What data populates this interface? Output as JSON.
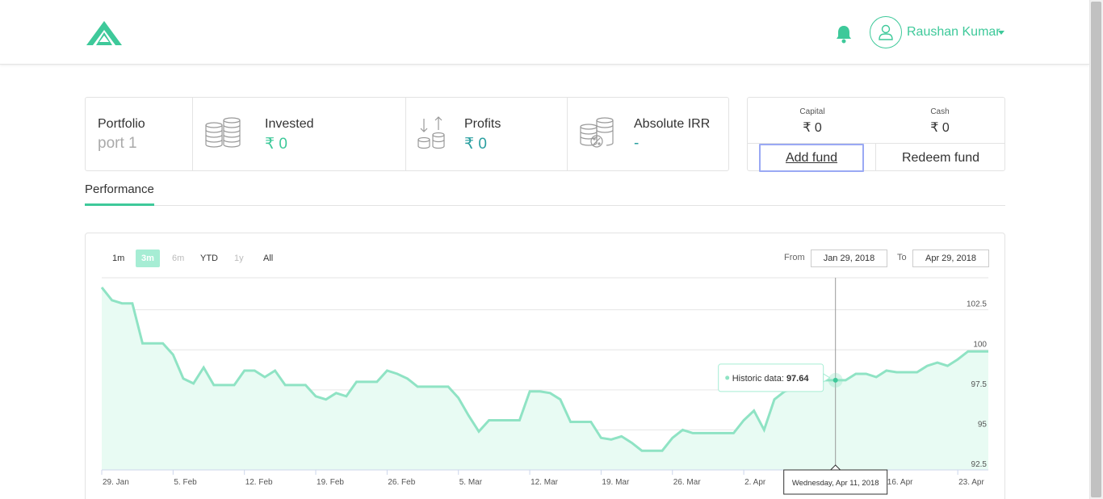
{
  "header": {
    "logo": "logo-icon",
    "bell": "bell-icon",
    "user_name": "Raushan Kumar"
  },
  "summary": {
    "portfolio_label": "Portfolio",
    "portfolio_value": "port 1",
    "invested_label": "Invested",
    "invested_value": "₹ 0",
    "profits_label": "Profits",
    "profits_value": "₹ 0",
    "irr_label": "Absolute IRR",
    "irr_value": "-"
  },
  "funds": {
    "capital_label": "Capital",
    "capital_value": "₹ 0",
    "cash_label": "Cash",
    "cash_value": "₹ 0",
    "add_label": "Add fund",
    "redeem_label": "Redeem fund"
  },
  "tabs": {
    "performance": "Performance"
  },
  "range": {
    "buttons": [
      {
        "label": "1m",
        "state": "normal"
      },
      {
        "label": "3m",
        "state": "active"
      },
      {
        "label": "6m",
        "state": "disabled"
      },
      {
        "label": "YTD",
        "state": "normal"
      },
      {
        "label": "1y",
        "state": "disabled"
      },
      {
        "label": "All",
        "state": "normal"
      }
    ],
    "from_label": "From",
    "from_value": "Jan 29, 2018",
    "to_label": "To",
    "to_value": "Apr 29, 2018"
  },
  "colors": {
    "accent": "#3ec99a",
    "line": "#8fe3c4",
    "fill": "#e8fbf3"
  },
  "tooltip": {
    "series_label": "Historic data:",
    "value": "97.64",
    "date": "Wednesday, Apr 11, 2018"
  },
  "chart_data": {
    "type": "area",
    "x_start": "2018-01-29",
    "x_end": "2018-04-29",
    "ylim": [
      92.5,
      104.5
    ],
    "y_ticks": [
      "92.5",
      "95",
      "97.5",
      "100",
      "102.5"
    ],
    "x_ticks": [
      "29. Jan",
      "5. Feb",
      "12. Feb",
      "19. Feb",
      "26. Feb",
      "5. Mar",
      "12. Mar",
      "19. Mar",
      "26. Mar",
      "2. Apr",
      "9. Apr",
      "16. Apr",
      "23. Apr"
    ],
    "series": [
      {
        "values": [
          [
            0,
            103.9
          ],
          [
            1,
            103.1
          ],
          [
            2,
            102.9
          ],
          [
            3,
            102.9
          ],
          [
            4,
            100.4
          ],
          [
            5,
            100.4
          ],
          [
            6,
            100.4
          ],
          [
            7,
            99.7
          ],
          [
            8,
            98.2
          ],
          [
            9,
            97.9
          ],
          [
            10,
            98.9
          ],
          [
            11,
            97.8
          ],
          [
            12,
            97.8
          ],
          [
            13,
            97.8
          ],
          [
            14,
            98.7
          ],
          [
            15,
            98.7
          ],
          [
            16,
            98.3
          ],
          [
            17,
            98.7
          ],
          [
            18,
            97.8
          ],
          [
            19,
            97.8
          ],
          [
            20,
            97.8
          ],
          [
            21,
            97.1
          ],
          [
            22,
            96.9
          ],
          [
            23,
            97.3
          ],
          [
            24,
            97.1
          ],
          [
            25,
            98
          ],
          [
            26,
            98
          ],
          [
            27,
            98
          ],
          [
            28,
            98.7
          ],
          [
            29,
            98.5
          ],
          [
            30,
            98.2
          ],
          [
            31,
            97.7
          ],
          [
            32,
            97.7
          ],
          [
            33,
            97.7
          ],
          [
            34,
            97.7
          ],
          [
            35,
            97
          ],
          [
            36,
            95.9
          ],
          [
            37,
            94.9
          ],
          [
            38,
            95.6
          ],
          [
            39,
            95.6
          ],
          [
            40,
            95.6
          ],
          [
            41,
            95.6
          ],
          [
            42,
            97.4
          ],
          [
            43,
            97.4
          ],
          [
            44,
            97.3
          ],
          [
            45,
            96.9
          ],
          [
            46,
            95.5
          ],
          [
            47,
            95.5
          ],
          [
            48,
            95.5
          ],
          [
            49,
            94.5
          ],
          [
            50,
            94.4
          ],
          [
            51,
            94.6
          ],
          [
            52,
            94.2
          ],
          [
            53,
            93.7
          ],
          [
            54,
            93.7
          ],
          [
            55,
            93.7
          ],
          [
            56,
            94.5
          ],
          [
            57,
            95
          ],
          [
            58,
            94.8
          ],
          [
            59,
            94.8
          ],
          [
            60,
            94.8
          ],
          [
            61,
            94.8
          ],
          [
            62,
            94.8
          ],
          [
            63,
            95.6
          ],
          [
            64,
            96.2
          ],
          [
            65,
            95
          ],
          [
            66,
            96.9
          ],
          [
            67,
            97.4
          ],
          [
            68,
            97.6
          ],
          [
            69,
            97.6
          ],
          [
            70,
            98
          ],
          [
            71,
            98.1
          ],
          [
            72,
            98.1
          ],
          [
            73,
            98.1
          ],
          [
            74,
            98.5
          ],
          [
            75,
            98.5
          ],
          [
            76,
            98.3
          ],
          [
            77,
            98.7
          ],
          [
            78,
            98.6
          ],
          [
            79,
            98.6
          ],
          [
            80,
            98.6
          ],
          [
            81,
            99
          ],
          [
            82,
            99.2
          ],
          [
            83,
            99
          ],
          [
            84,
            99.4
          ],
          [
            85,
            99.9
          ],
          [
            86,
            99.9
          ],
          [
            87,
            99.9
          ]
        ]
      }
    ],
    "hover_index": 72,
    "grid": true
  }
}
